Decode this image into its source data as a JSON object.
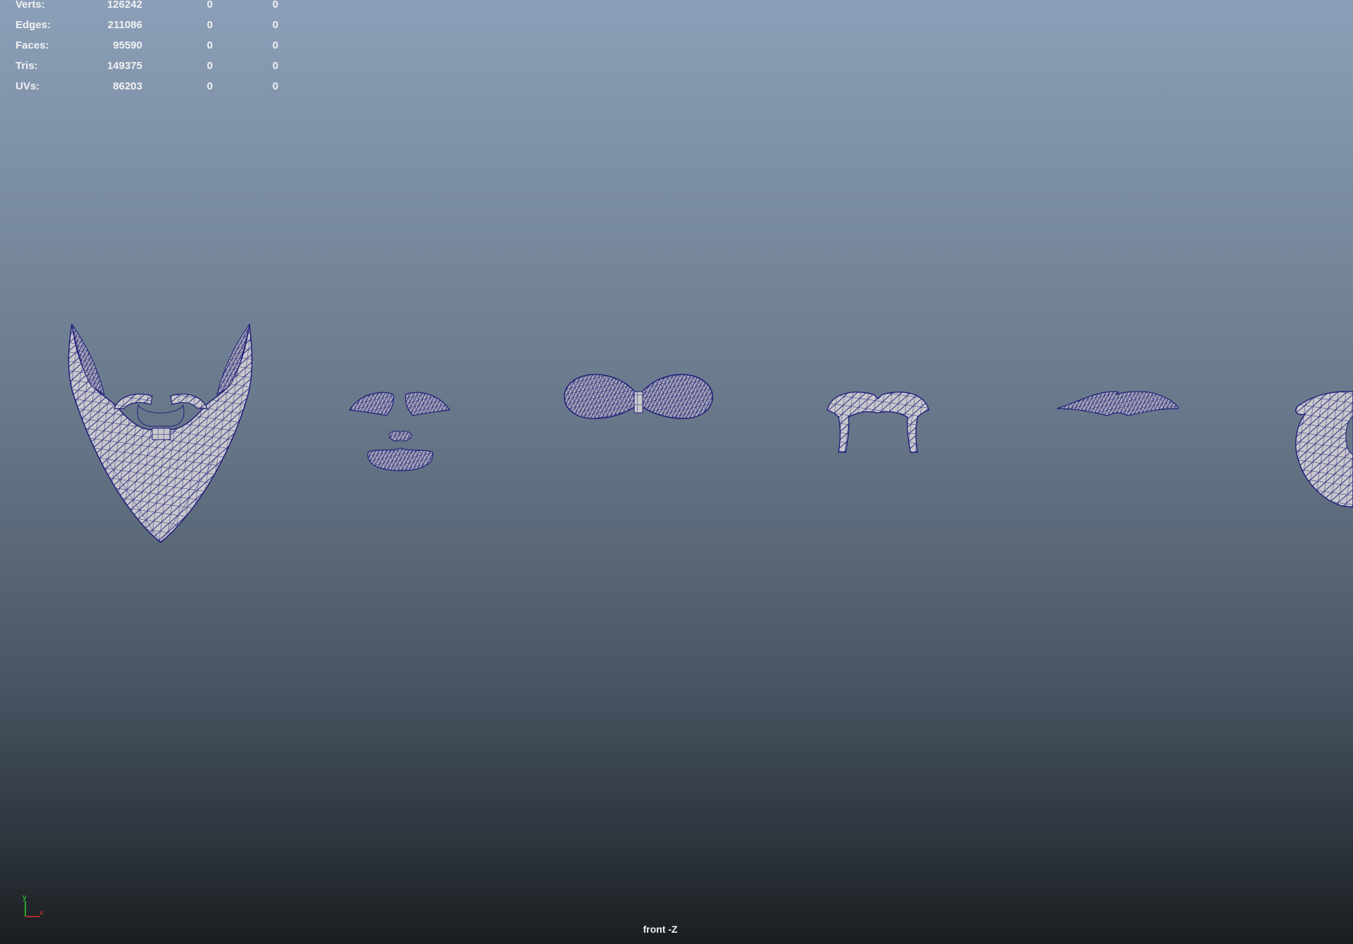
{
  "hud": {
    "rows": [
      {
        "label": "Verts:",
        "total": "126242",
        "selected": "0",
        "extra": "0"
      },
      {
        "label": "Edges:",
        "total": "211086",
        "selected": "0",
        "extra": "0"
      },
      {
        "label": "Faces:",
        "total": "95590",
        "selected": "0",
        "extra": "0"
      },
      {
        "label": "Tris:",
        "total": "149375",
        "selected": "0",
        "extra": "0"
      },
      {
        "label": "UVs:",
        "total": "86203",
        "selected": "0",
        "extra": "0"
      }
    ]
  },
  "viewport": {
    "camera_label": "front -Z",
    "axis": {
      "y_label": "y",
      "x_label": "x"
    },
    "colors": {
      "wireframe": "#1f1f7a",
      "mesh_fill": "#c9c8cc",
      "axis_y": "#2fd02f",
      "axis_x": "#e03030"
    },
    "meshes": [
      {
        "name": "full-beard-with-mustache"
      },
      {
        "name": "goatee-with-mustache"
      },
      {
        "name": "bushy-mustache"
      },
      {
        "name": "horseshoe-mustache"
      },
      {
        "name": "thin-handlebar-mustache"
      },
      {
        "name": "partial-beard-cut-off"
      }
    ]
  }
}
